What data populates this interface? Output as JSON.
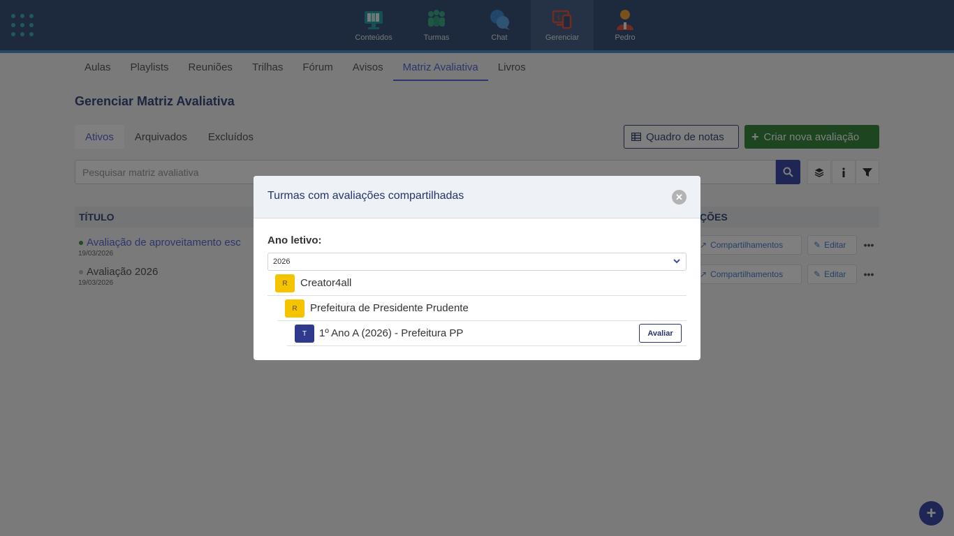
{
  "topnav": {
    "items": [
      {
        "label": "Conteúdos",
        "icon": "monitor-books-icon"
      },
      {
        "label": "Turmas",
        "icon": "people-group-icon"
      },
      {
        "label": "Chat",
        "icon": "chat-bubbles-icon"
      },
      {
        "label": "Gerenciar",
        "icon": "manage-devices-icon"
      },
      {
        "label": "Pedro",
        "icon": "user-avatar-icon"
      }
    ],
    "active": "Gerenciar"
  },
  "subnav": {
    "items": [
      "Aulas",
      "Playlists",
      "Reuniões",
      "Trilhas",
      "Fórum",
      "Avisos",
      "Matriz Avaliativa",
      "Livros"
    ],
    "active": "Matriz Avaliativa"
  },
  "page": {
    "title": "Gerenciar Matriz Avaliativa",
    "tabs": [
      "Ativos",
      "Arquivados",
      "Excluídos"
    ],
    "active_tab": "Ativos",
    "quadro_label": "Quadro de notas",
    "criar_label": "Criar nova avaliação",
    "search_placeholder": "Pesquisar matriz avaliativa"
  },
  "table": {
    "headers": {
      "title": "TÍTULO",
      "acoes": "AÇÕES"
    },
    "headers_visible": {
      "acoes": "ÇÕES"
    },
    "rows": [
      {
        "title": "Avaliação de aproveitamento escolar",
        "visible_title": "Avaliação de aproveitamento esc",
        "date": "19/03/2026",
        "status_color": "#3a9a3f",
        "title_color": "#5b6bd6"
      },
      {
        "title": "Avaliação 2026",
        "visible_title": "Avaliação 2026",
        "date": "19/03/2026",
        "status_color": "#bbbbbb",
        "title_color": "#555555"
      }
    ],
    "compartilhamentos_label": "Compartilhamentos",
    "editar_label": "Editar",
    "more_label": "•••"
  },
  "modal": {
    "title": "Turmas com avaliações compartilhadas",
    "ano_label": "Ano letivo:",
    "ano_value": "2026",
    "tree": [
      {
        "badge": "R",
        "label": "Creator4all",
        "level": 0,
        "badge_color": "#f5c400"
      },
      {
        "badge": "R",
        "label": "Prefeitura de Presidente Prudente",
        "level": 1,
        "badge_color": "#f5c400"
      },
      {
        "badge": "T",
        "label": "1º Ano A (2026) - Prefeitura PP",
        "level": 2,
        "badge_color": "#2f3a8f"
      }
    ],
    "avaliar_label": "Avaliar"
  },
  "fab_label": "+"
}
